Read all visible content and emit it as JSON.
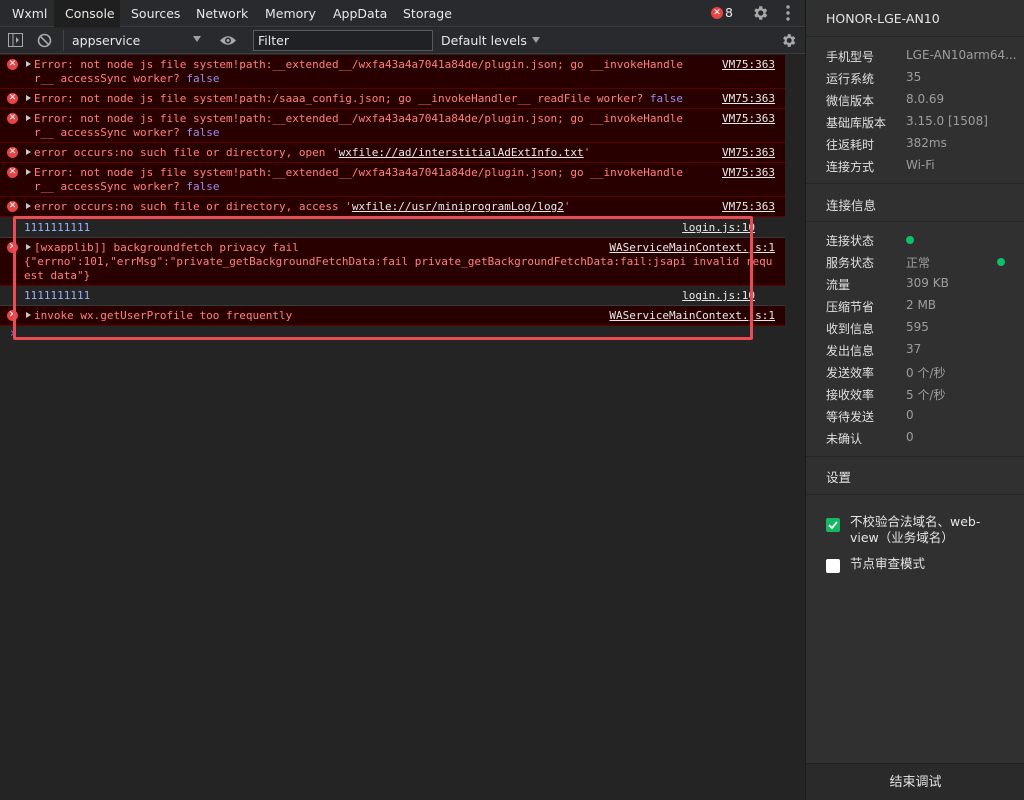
{
  "tabs": [
    "Wxml",
    "Console",
    "Sources",
    "Network",
    "Memory",
    "AppData",
    "Storage"
  ],
  "error_count": "8",
  "toolbar": {
    "context": "appservice",
    "filter_placeholder": "Filter",
    "levels": "Default levels"
  },
  "messages": [
    {
      "type": "error",
      "text": "Error: not node js file system!path:__extended__/wxfa43a4a7041a84de/plugin.json; go __invokeHandler__ accessSync worker? ",
      "kw": "false",
      "source": "VM75:363"
    },
    {
      "type": "error",
      "text": "Error: not node js file system!path:/saaa_config.json; go __invokeHandler__ readFile worker? ",
      "kw": "false",
      "source": "VM75:363"
    },
    {
      "type": "error",
      "text": "Error: not node js file system!path:__extended__/wxfa43a4a7041a84de/plugin.json; go __invokeHandler__ accessSync worker? ",
      "kw": "false",
      "source": "VM75:363"
    },
    {
      "type": "error",
      "text_pre": "error occurs:no such file or directory, open '",
      "link": "wxfile://ad/interstitialAdExtInfo.txt",
      "text_post": "'",
      "source": "VM75:363"
    },
    {
      "type": "error",
      "text": "Error: not node js file system!path:__extended__/wxfa43a4a7041a84de/plugin.json; go __invokeHandler__ accessSync worker? ",
      "kw": "false",
      "source": "VM75:363"
    },
    {
      "type": "error",
      "text_pre": "error occurs:no such file or directory, access '",
      "link": "wxfile://usr/miniprogramLog/log2",
      "text_post": "'",
      "source": "VM75:363"
    },
    {
      "type": "log",
      "text": "1111111111",
      "source": "login.js:10"
    },
    {
      "type": "error",
      "text": "[wxapplib]] backgroundfetch privacy fail",
      "extra": "{\"errno\":101,\"errMsg\":\"private_getBackgroundFetchData:fail private_getBackgroundFetchData:fail:jsapi invalid request data\"}",
      "source": "WAServiceMainContext.js:1"
    },
    {
      "type": "log",
      "text": "1111111111",
      "source": "login.js:10"
    },
    {
      "type": "error",
      "text": "invoke wx.getUserProfile too frequently",
      "source": "WAServiceMainContext.js:1"
    }
  ],
  "device": {
    "title": "HONOR-LGE-AN10",
    "info": [
      {
        "k": "手机型号",
        "v": "LGE-AN10arm64..."
      },
      {
        "k": "运行系统",
        "v": "35"
      },
      {
        "k": "微信版本",
        "v": "8.0.69"
      },
      {
        "k": "基础库版本",
        "v": "3.15.0 [1508]"
      },
      {
        "k": "往返耗时",
        "v": "382ms"
      },
      {
        "k": "连接方式",
        "v": "Wi-Fi"
      }
    ],
    "conn_title": "连接信息",
    "conn": [
      {
        "k": "连接状态",
        "v": ""
      },
      {
        "k": "服务状态",
        "v": "正常"
      },
      {
        "k": "流量",
        "v": "309 KB"
      },
      {
        "k": "压缩节省",
        "v": "2 MB"
      },
      {
        "k": "收到信息",
        "v": "595"
      },
      {
        "k": "发出信息",
        "v": "37"
      },
      {
        "k": "发送效率",
        "v": "0 个/秒"
      },
      {
        "k": "接收效率",
        "v": "5 个/秒"
      },
      {
        "k": "等待发送",
        "v": "0"
      },
      {
        "k": "未确认",
        "v": "0"
      }
    ],
    "settings_title": "设置",
    "options": [
      {
        "label": "不校验合法域名、web-view（业务域名）",
        "checked": true
      },
      {
        "label": "节点审查模式",
        "checked": false
      }
    ],
    "end_button": "结束调试"
  },
  "colors": {
    "error_bg": "#290000",
    "error_text": "#ff8080",
    "log_text": "#9cb0ff",
    "highlight": "#ea4b55",
    "status_green": "#0fc06a"
  }
}
